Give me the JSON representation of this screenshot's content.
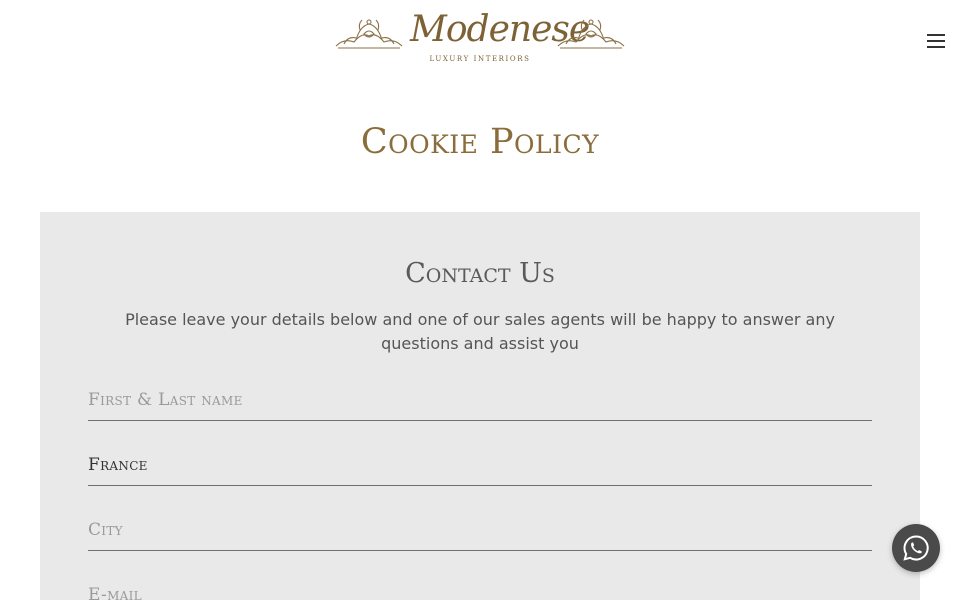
{
  "header": {
    "logo_text": "Modenese",
    "logo_subtext": "LUXURY INTERIORS",
    "menu_icon": "hamburger-icon"
  },
  "page": {
    "title": "Cookie Policy"
  },
  "contact": {
    "heading": "Contact Us",
    "description": "Please leave your details below and one of our sales agents will be happy to answer any questions and assist you",
    "fields": [
      {
        "placeholder": "First & Last name",
        "value": ""
      },
      {
        "placeholder": "",
        "value": "France"
      },
      {
        "placeholder": "City",
        "value": ""
      },
      {
        "placeholder": "E-mail",
        "value": ""
      }
    ]
  },
  "whatsapp": {
    "icon": "whatsapp-icon"
  },
  "colors": {
    "gold": "#8a6d3b",
    "panel_bg": "#e9e9e9",
    "whatsapp_bg": "#4a4a4a"
  }
}
